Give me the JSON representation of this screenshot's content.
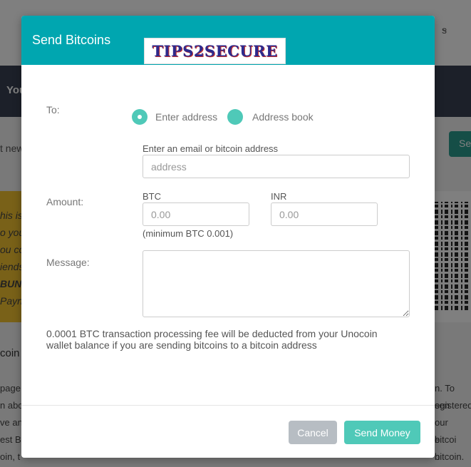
{
  "background": {
    "nav_text": "s",
    "nav_chevron": "chevron-down-icon",
    "darkbar_text": "You",
    "left_text": "t new",
    "send_button_label": "Se",
    "yellow_lines": [
      "his is",
      "o you",
      "ou co",
      "iends",
      "",
      "BUN",
      "Payn"
    ],
    "section_title": "coin",
    "body_left": [
      "page o",
      "n abo",
      "ve an",
      "est B",
      "oin, t",
      "n"
    ],
    "body_right": [
      "n. To sen",
      "egistered",
      "our bitcoi",
      "e bitcoin.",
      "n Unocol",
      ""
    ]
  },
  "modal": {
    "title": "Send Bitcoins",
    "watermark_text": "TIPS2SECURE",
    "to_label": "To:",
    "radio_enter_address": "Enter address",
    "radio_address_book": "Address book",
    "address_label": "Enter an email or bitcoin address",
    "address_placeholder": "address",
    "amount_label": "Amount:",
    "btc_label": "BTC",
    "btc_placeholder": "0.00",
    "inr_label": "INR",
    "inr_placeholder": "0.00",
    "minimum_hint": "(minimum BTC 0.001)",
    "message_label": "Message:",
    "message_value": "",
    "fee_notice": "0.0001 BTC transaction processing fee will be deducted from your Unocoin wallet balance if you are sending bitcoins to a bitcoin address",
    "cancel_label": "Cancel",
    "send_label": "Send Money",
    "selected_recipient_mode": "Enter address",
    "accent_color": "#4fc9b8",
    "header_color": "#00a6b0"
  }
}
